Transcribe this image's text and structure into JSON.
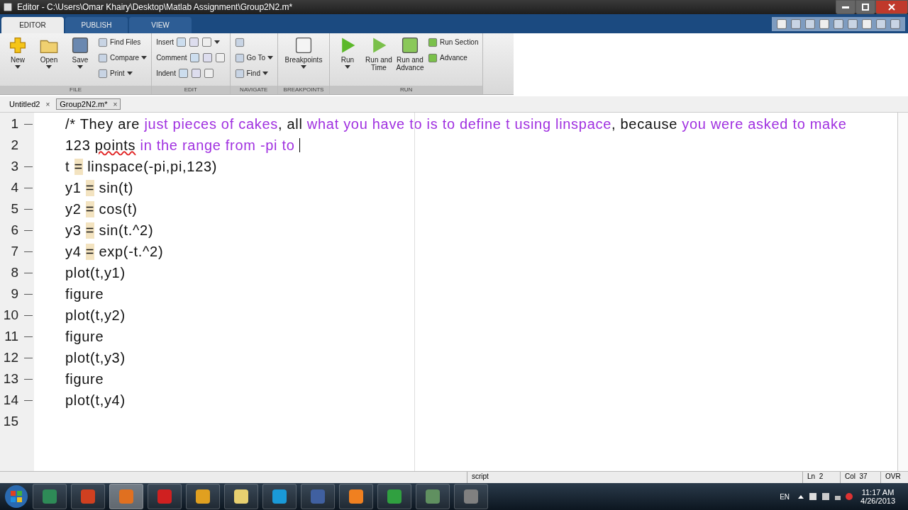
{
  "window": {
    "title": "Editor - C:\\Users\\Omar Khairy\\Desktop\\Matlab Assignment\\Group2N2.m*"
  },
  "ribbon_tabs": [
    {
      "label": "EDITOR",
      "selected": true
    },
    {
      "label": "PUBLISH",
      "selected": false
    },
    {
      "label": "VIEW",
      "selected": false
    }
  ],
  "ribbon_groups": [
    {
      "title": "FILE",
      "big": [
        {
          "label": "New",
          "menu": true
        },
        {
          "label": "Open",
          "menu": true
        },
        {
          "label": "Save",
          "menu": true
        }
      ],
      "small": [
        {
          "label": "Find Files",
          "menu": false
        },
        {
          "label": "Compare",
          "menu": true
        },
        {
          "label": "Print",
          "menu": true
        }
      ]
    },
    {
      "title": "EDIT",
      "small": [
        {
          "label": "Insert",
          "menu": true
        },
        {
          "label": "Comment",
          "menu": false
        },
        {
          "label": "Indent",
          "menu": false
        }
      ]
    },
    {
      "title": "NAVIGATE",
      "small": [
        {
          "menu": false
        },
        {
          "label": "Go To",
          "menu": true
        },
        {
          "label": "Find",
          "menu": true
        }
      ]
    },
    {
      "title": "BREAKPOINTS",
      "big": [
        {
          "label": "Breakpoints",
          "menu": true
        }
      ]
    },
    {
      "title": "RUN",
      "big": [
        {
          "label": "Run",
          "menu": true
        },
        {
          "label": "Run and Time",
          "menu": false
        },
        {
          "label": "Run and Advance",
          "menu": false
        }
      ],
      "small": [
        {
          "label": "Run Section",
          "menu": false
        },
        {
          "label": "Advance",
          "menu": false
        }
      ]
    }
  ],
  "document_tabs": [
    {
      "label": "Untitled2",
      "selected": false,
      "close": "×"
    },
    {
      "label": "Group2N2.m*",
      "selected": true,
      "close": "×"
    }
  ],
  "editor": {
    "lines": [
      {
        "number": "1",
        "marker": "—",
        "segments": [
          {
            "text": "/* They are ",
            "kind": "code"
          },
          {
            "text": "just pieces of cakes",
            "kind": "comment"
          },
          {
            "text": ", all ",
            "kind": "code"
          },
          {
            "text": "what you have to is ",
            "kind": "comment"
          },
          {
            "text": "to define t using linspace",
            "kind": "comment"
          },
          {
            "text": ", because ",
            "kind": "code"
          },
          {
            "text": "you were asked to make",
            "kind": "comment"
          }
        ]
      },
      {
        "number": "2",
        "segments": [
          {
            "text": "123 ",
            "kind": "code"
          },
          {
            "text": "points",
            "kind": "misspelled"
          },
          {
            "text": " in the range from -pi to ",
            "kind": "comment"
          }
        ],
        "cursor": true
      },
      {
        "number": "3",
        "marker": "—",
        "segments": [
          {
            "text": "t ",
            "kind": "code"
          },
          {
            "text": "=",
            "kind": "highlight"
          },
          {
            "text": " linspace(-pi,pi,123)",
            "kind": "code"
          }
        ]
      },
      {
        "number": "4",
        "marker": "—",
        "segments": [
          {
            "text": "y1 ",
            "kind": "code"
          },
          {
            "text": "=",
            "kind": "highlight"
          },
          {
            "text": " sin(t)",
            "kind": "code"
          }
        ]
      },
      {
        "number": "5",
        "marker": "—",
        "segments": [
          {
            "text": "y2 ",
            "kind": "code"
          },
          {
            "text": "=",
            "kind": "highlight"
          },
          {
            "text": " cos(t)",
            "kind": "code"
          }
        ]
      },
      {
        "number": "6",
        "marker": "—",
        "segments": [
          {
            "text": "y3 ",
            "kind": "code"
          },
          {
            "text": "=",
            "kind": "highlight"
          },
          {
            "text": " sin(t.^2)",
            "kind": "code"
          }
        ]
      },
      {
        "number": "7",
        "marker": "—",
        "segments": [
          {
            "text": "y4 ",
            "kind": "code"
          },
          {
            "text": "=",
            "kind": "highlight"
          },
          {
            "text": " exp(-t.^2)",
            "kind": "code"
          }
        ]
      },
      {
        "number": "8",
        "marker": "—",
        "segments": [
          {
            "text": "plot(t,y1)",
            "kind": "code"
          }
        ]
      },
      {
        "number": "9",
        "marker": "—",
        "segments": [
          {
            "text": "figure",
            "kind": "code"
          }
        ]
      },
      {
        "number": "10",
        "marker": "—",
        "segments": [
          {
            "text": "plot(t,y2)",
            "kind": "code"
          }
        ]
      },
      {
        "number": "11",
        "marker": "—",
        "segments": [
          {
            "text": "figure",
            "kind": "code"
          }
        ]
      },
      {
        "number": "12",
        "marker": "—",
        "segments": [
          {
            "text": "plot(t,y3)",
            "kind": "code"
          }
        ]
      },
      {
        "number": "13",
        "marker": "—",
        "segments": [
          {
            "text": "figure",
            "kind": "code"
          }
        ]
      },
      {
        "number": "14",
        "marker": "—",
        "segments": [
          {
            "text": "plot(t,y4)",
            "kind": "code"
          }
        ]
      },
      {
        "number": "15"
      }
    ]
  },
  "status_bar": {
    "mode": "script",
    "line": "Ln  2",
    "column": "Col  37",
    "overwrite": "OVR"
  },
  "taskbar": {
    "apps": [
      {
        "kind": "start"
      },
      {
        "kind": "app",
        "color": "#2e8b57",
        "active": false
      },
      {
        "kind": "app",
        "color": "#d04020",
        "active": false
      },
      {
        "kind": "app",
        "color": "#e07020",
        "active": true
      },
      {
        "kind": "app",
        "color": "#d02020",
        "active": false
      },
      {
        "kind": "app",
        "color": "#e0a020",
        "active": false
      },
      {
        "kind": "app",
        "color": "#e8d070",
        "active": false
      },
      {
        "kind": "app",
        "color": "#1a9ad8",
        "active": false
      },
      {
        "kind": "app",
        "color": "#4060a0",
        "active": false
      },
      {
        "kind": "app",
        "color": "#f08020",
        "active": false
      },
      {
        "kind": "app",
        "color": "#30a040",
        "active": false
      },
      {
        "kind": "app",
        "color": "#609060",
        "active": false
      },
      {
        "kind": "app",
        "color": "#808080",
        "active": false
      }
    ],
    "language": "EN",
    "time": "11:17 AM",
    "date": "4/26/2013"
  }
}
